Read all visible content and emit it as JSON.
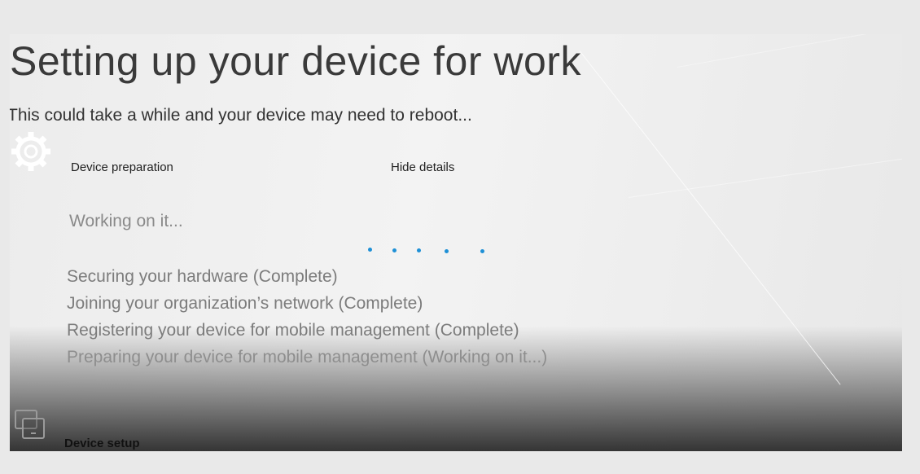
{
  "header": {
    "title": "Setting up your device for work",
    "subtitle": "This could take a while and your device may need to reboot..."
  },
  "device_preparation": {
    "icon": "gear-icon",
    "label": "Device preparation",
    "toggle_label": "Hide details",
    "status": "Working on it...",
    "steps": [
      "Securing your hardware (Complete)",
      "Joining your organization’s network (Complete)",
      "Registering your device for mobile management (Complete)",
      "Preparing your device for mobile management (Working on it...)"
    ]
  },
  "device_setup": {
    "icon": "device-icon",
    "label": "Device setup"
  },
  "colors": {
    "progress_dots": "#1e90d6"
  }
}
